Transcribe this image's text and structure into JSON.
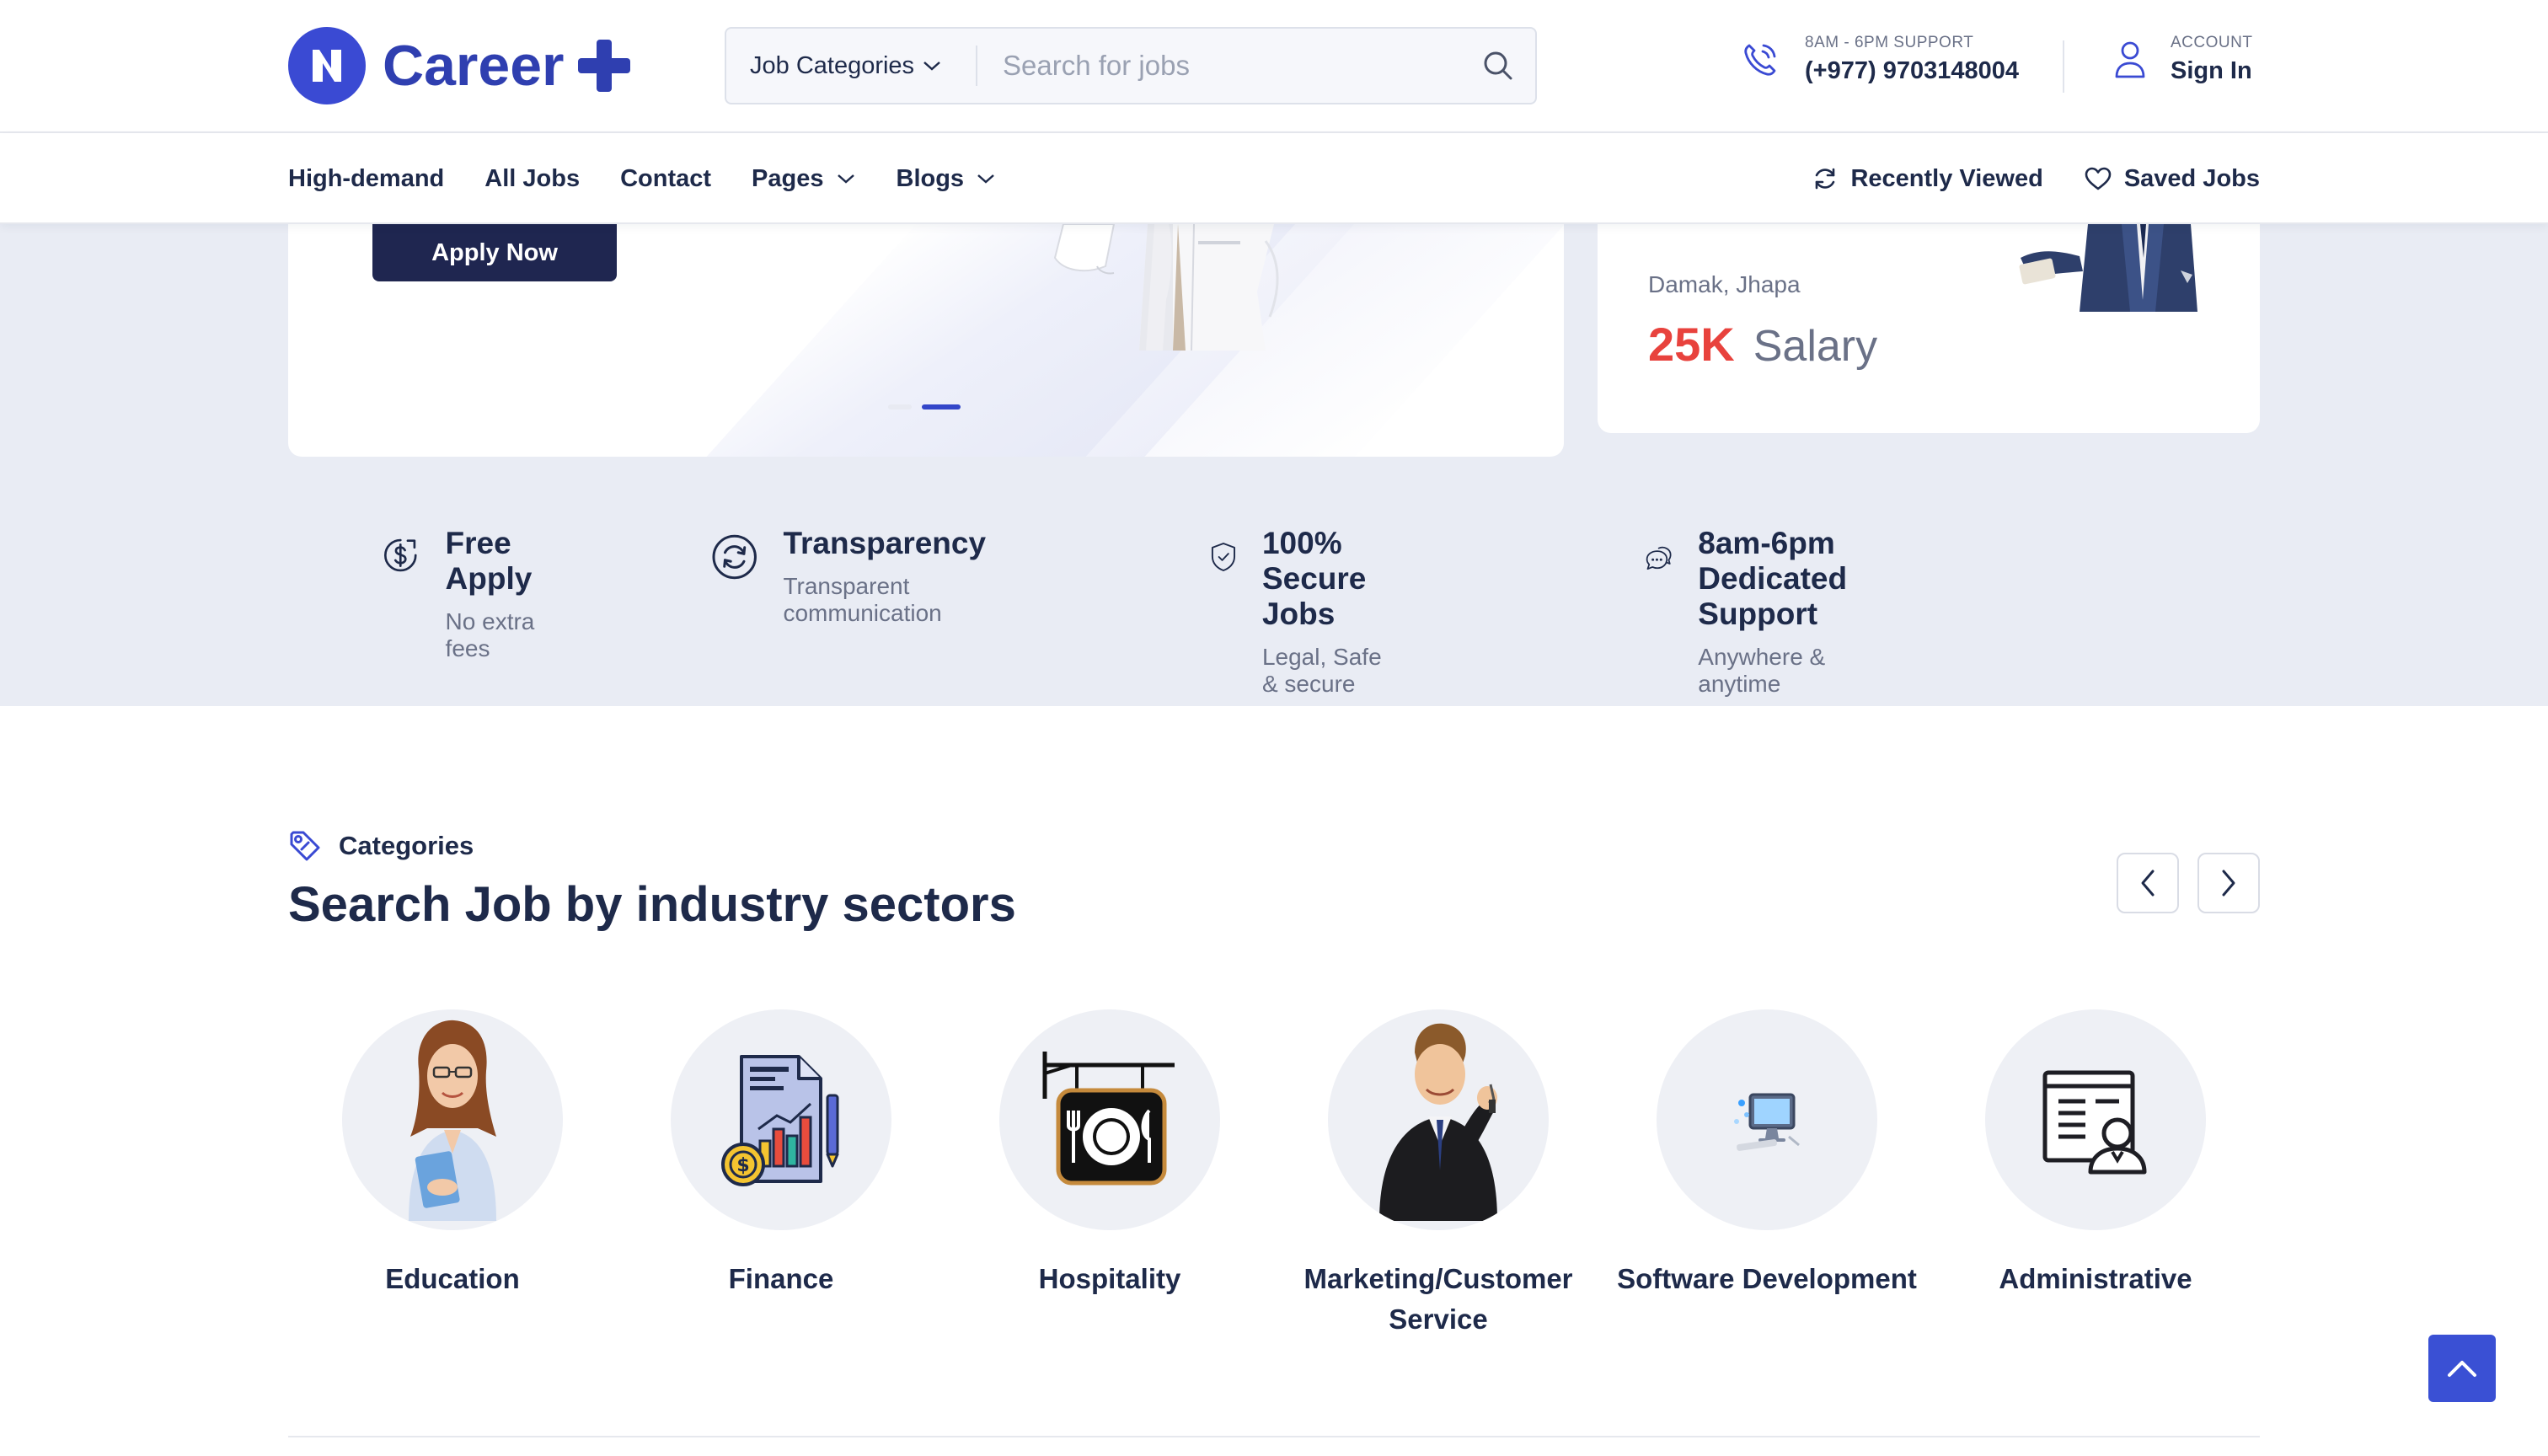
{
  "header": {
    "brand": "Career",
    "search": {
      "category_label": "Job Categories",
      "placeholder": "Search for jobs"
    },
    "support": {
      "label": "8AM - 6PM SUPPORT",
      "phone": "(+977) 9703148004"
    },
    "account": {
      "label": "ACCOUNT",
      "action": "Sign In"
    }
  },
  "nav": {
    "items": [
      {
        "label": "High-demand"
      },
      {
        "label": "All Jobs"
      },
      {
        "label": "Contact"
      },
      {
        "label": "Pages"
      },
      {
        "label": "Blogs"
      }
    ],
    "recently_viewed": "Recently Viewed",
    "saved_jobs": "Saved Jobs"
  },
  "hero": {
    "apply_label": "Apply Now",
    "side_card": {
      "location": "Damak, Jhapa",
      "salary_amount": "25K",
      "salary_label": "Salary"
    }
  },
  "features": [
    {
      "title": "Free Apply",
      "subtitle": "No extra fees",
      "icon": "dollar-circle-icon"
    },
    {
      "title": "Transparency",
      "subtitle": "Transparent communication",
      "icon": "refresh-circle-icon"
    },
    {
      "title": "100% Secure Jobs",
      "subtitle": "Legal, Safe & secure",
      "icon": "shield-check-icon"
    },
    {
      "title": "8am-6pm Dedicated Support",
      "subtitle": "Anywhere & anytime",
      "icon": "chat-bubbles-icon"
    }
  ],
  "categories": {
    "tag": "Categories",
    "title": "Search Job by industry sectors",
    "items": [
      {
        "label": "Education",
        "icon": "teacher-icon"
      },
      {
        "label": "Finance",
        "icon": "finance-report-icon"
      },
      {
        "label": "Hospitality",
        "icon": "restaurant-sign-icon"
      },
      {
        "label": "Marketing/Customer Service",
        "icon": "salesman-icon"
      },
      {
        "label": "Software Development",
        "icon": "computer-icon"
      },
      {
        "label": "Administrative",
        "icon": "admin-document-icon"
      }
    ]
  },
  "colors": {
    "brand": "#2f3fb0",
    "accent": "#3a50d4",
    "salary": "#e8423d",
    "dark": "#1e2a4a"
  }
}
